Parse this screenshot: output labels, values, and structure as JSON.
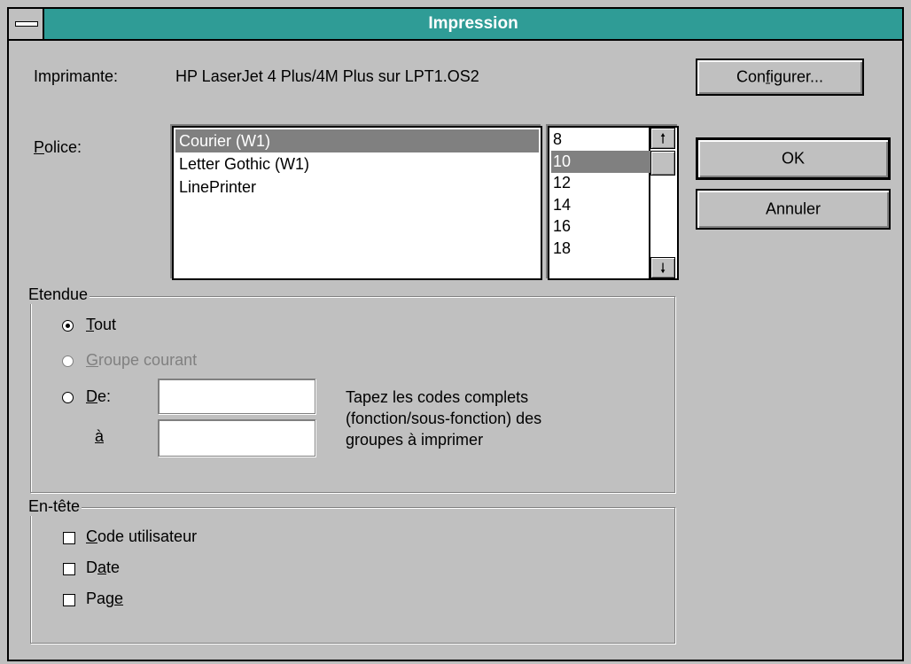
{
  "window": {
    "title": "Impression"
  },
  "printer": {
    "label": "Imprimante:",
    "value": "HP LaserJet 4 Plus/4M Plus sur LPT1.OS2"
  },
  "buttons": {
    "configure": "Configurer...",
    "ok": "OK",
    "cancel": "Annuler"
  },
  "font": {
    "label": "Police:",
    "items": [
      {
        "label": "Courier (W1)",
        "selected": true
      },
      {
        "label": "Letter Gothic (W1)",
        "selected": false
      },
      {
        "label": "LinePrinter",
        "selected": false
      }
    ]
  },
  "size": {
    "items": [
      {
        "label": "8",
        "selected": false
      },
      {
        "label": "10",
        "selected": true
      },
      {
        "label": "12",
        "selected": false
      },
      {
        "label": "14",
        "selected": false
      },
      {
        "label": "16",
        "selected": false
      },
      {
        "label": "18",
        "selected": false
      }
    ],
    "scroll_up_icon": "arrow-up-icon",
    "scroll_down_icon": "arrow-down-icon"
  },
  "range": {
    "label": "Etendue",
    "all": "Tout",
    "current_group": "Groupe courant",
    "from": "De:",
    "to": "à",
    "from_value": "",
    "to_value": "",
    "selected": "all",
    "hint": [
      "Tapez les codes complets",
      "(fonction/sous-fonction) des",
      "groupes à imprimer"
    ]
  },
  "header": {
    "label": "En-tête",
    "user_code": "Code utilisateur",
    "date": "Date",
    "page": "Page",
    "user_code_checked": false,
    "date_checked": false,
    "page_checked": false
  },
  "colors": {
    "titlebar": "#2f9c96",
    "face": "#c0c0c0",
    "selection": "#808080"
  }
}
